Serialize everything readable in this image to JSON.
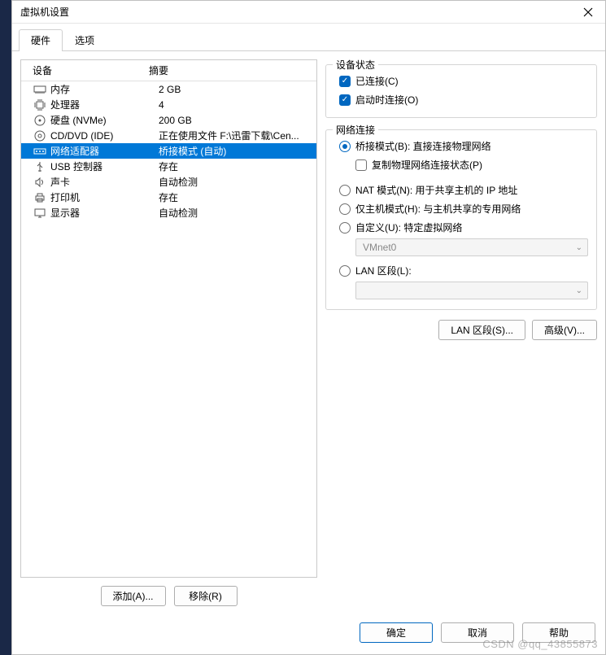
{
  "window": {
    "title": "虚拟机设置"
  },
  "tabs": {
    "hardware": "硬件",
    "options": "选项"
  },
  "columns": {
    "device": "设备",
    "summary": "摘要"
  },
  "devices": [
    {
      "icon": "memory-icon",
      "name": "内存",
      "summary": "2 GB"
    },
    {
      "icon": "cpu-icon",
      "name": "处理器",
      "summary": "4"
    },
    {
      "icon": "disk-icon",
      "name": "硬盘 (NVMe)",
      "summary": "200 GB"
    },
    {
      "icon": "cd-icon",
      "name": "CD/DVD (IDE)",
      "summary": "正在使用文件 F:\\迅雷下载\\Cen..."
    },
    {
      "icon": "network-icon",
      "name": "网络适配器",
      "summary": "桥接模式 (自动)"
    },
    {
      "icon": "usb-icon",
      "name": "USB 控制器",
      "summary": "存在"
    },
    {
      "icon": "sound-icon",
      "name": "声卡",
      "summary": "自动检测"
    },
    {
      "icon": "printer-icon",
      "name": "打印机",
      "summary": "存在"
    },
    {
      "icon": "display-icon",
      "name": "显示器",
      "summary": "自动检测"
    }
  ],
  "selected_device_index": 4,
  "left_buttons": {
    "add": "添加(A)...",
    "remove": "移除(R)"
  },
  "device_status": {
    "legend": "设备状态",
    "connected": {
      "label": "已连接(C)",
      "checked": true
    },
    "connect_at_power_on": {
      "label": "启动时连接(O)",
      "checked": true
    }
  },
  "network_connection": {
    "legend": "网络连接",
    "bridged": {
      "label": "桥接模式(B): 直接连接物理网络",
      "selected": true
    },
    "replicate": {
      "label": "复制物理网络连接状态(P)",
      "checked": false
    },
    "nat": {
      "label": "NAT 模式(N): 用于共享主机的 IP 地址",
      "selected": false
    },
    "hostonly": {
      "label": "仅主机模式(H): 与主机共享的专用网络",
      "selected": false
    },
    "custom": {
      "label": "自定义(U): 特定虚拟网络",
      "selected": false
    },
    "custom_value": "VMnet0",
    "lan_segment": {
      "label": "LAN 区段(L):",
      "selected": false
    },
    "lan_segment_value": ""
  },
  "right_buttons": {
    "lan_segments": "LAN 区段(S)...",
    "advanced": "高级(V)..."
  },
  "footer": {
    "ok": "确定",
    "cancel": "取消",
    "help": "帮助"
  },
  "watermark": "CSDN @qq_43855873"
}
